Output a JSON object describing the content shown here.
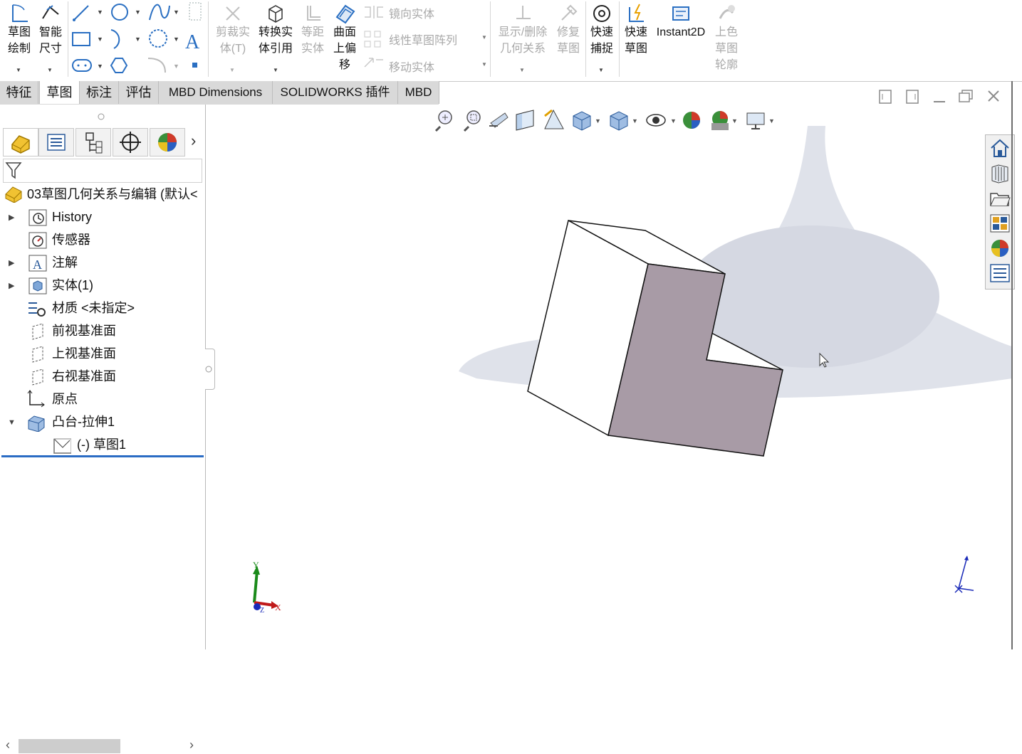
{
  "ribbon": {
    "sketch_draw": [
      "草图",
      "绘制"
    ],
    "smart_dim": [
      "智能",
      "尺寸"
    ],
    "trim": [
      "剪裁实",
      "体(T)"
    ],
    "convert": [
      "转换实",
      "体引用"
    ],
    "offset_equal": [
      "等距",
      "实体"
    ],
    "offset_surface": [
      "曲面",
      "上偏",
      "移"
    ],
    "mirror": "镜向实体",
    "linear_pattern": "线性草图阵列",
    "move": "移动实体",
    "show_relations": [
      "显示/删除",
      "几何关系"
    ],
    "repair": [
      "修复",
      "草图"
    ],
    "quick_snap": [
      "快速",
      "捕捉"
    ],
    "rapid_sketch": [
      "快速",
      "草图"
    ],
    "instant2d": "Instant2D",
    "shaded": [
      "上色",
      "草图",
      "轮廓"
    ]
  },
  "tabs": [
    "特征",
    "草图",
    "标注",
    "评估",
    "MBD Dimensions",
    "SOLIDWORKS 插件",
    "MBD"
  ],
  "active_tab": "草图",
  "tree": {
    "root": "03草图几何关系与编辑  (默认<",
    "items": [
      "History",
      "传感器",
      "注解",
      "实体(1)",
      "材质 <未指定>",
      "前视基准面",
      "上视基准面",
      "右视基准面",
      "原点",
      "凸台-拉伸1",
      "(-) 草图1"
    ]
  },
  "triad": {
    "x": "X",
    "y": "Y",
    "z": "Z"
  },
  "icons": {
    "window": [
      "restore-left-icon",
      "restore-right-icon",
      "minimize-icon",
      "maximize-icon",
      "close-icon"
    ],
    "panel_tabs": [
      "feature-manager-icon",
      "property-manager-icon",
      "configuration-manager-icon",
      "dimxpert-icon",
      "display-manager-icon"
    ],
    "task_pane": [
      "home-icon",
      "design-library-icon",
      "file-explorer-icon",
      "view-palette-icon",
      "appearances-icon",
      "custom-properties-icon"
    ]
  },
  "colors": {
    "accent": "#2b6cc4",
    "face": "#a89ba6",
    "shadow": "#dfe2ea",
    "tabbar": "#d9d9d9"
  }
}
